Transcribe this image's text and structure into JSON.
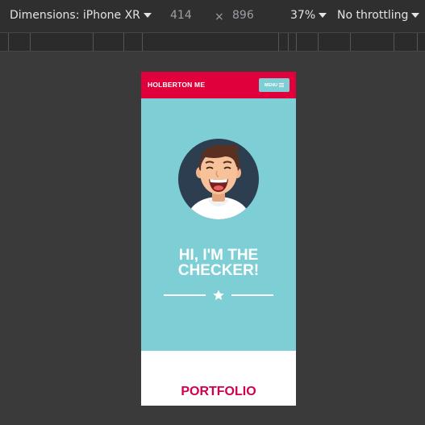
{
  "devtools": {
    "dimensions_label": "Dimensions: iPhone XR",
    "width": "414",
    "times": "×",
    "height": "896",
    "zoom": "37%",
    "throttling": "No throttling"
  },
  "site": {
    "brand": "HOLBERTON ME",
    "menu_label": "MENU",
    "hero_title_line1": "HI, I'M THE",
    "hero_title_line2": "CHECKER!",
    "section_title": "PORTFOLIO"
  },
  "colors": {
    "header": "#e0003c",
    "hero": "#7ecfd5",
    "avatar_bg": "#2c3e50",
    "section_title": "#d1004f"
  },
  "icons": {
    "menu": "hamburger-icon",
    "divider": "star-icon"
  }
}
